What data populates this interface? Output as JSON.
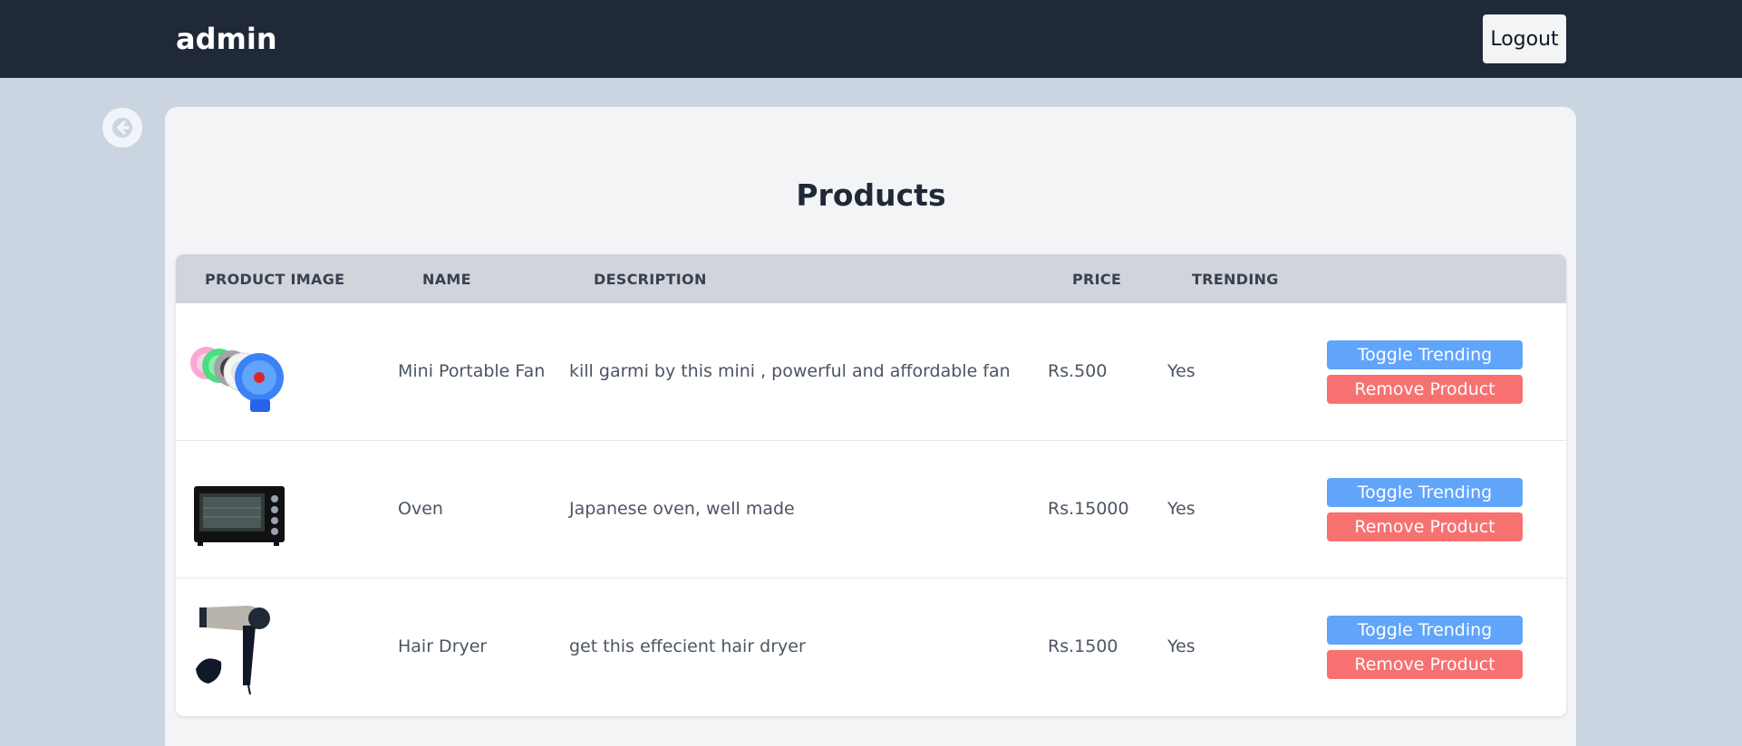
{
  "header": {
    "brand": "admin",
    "logout_label": "Logout"
  },
  "page": {
    "title": "Products"
  },
  "table": {
    "columns": [
      "PRODUCT IMAGE",
      "NAME",
      "DESCRIPTION",
      "PRICE",
      "TRENDING"
    ],
    "rows": [
      {
        "image": "mini-fan-image",
        "name": "Mini Portable Fan",
        "description": "kill garmi by this mini , powerful and affordable fan",
        "price": "Rs.500",
        "trending": "Yes"
      },
      {
        "image": "oven-image",
        "name": "Oven",
        "description": "Japanese oven, well made",
        "price": "Rs.15000",
        "trending": "Yes"
      },
      {
        "image": "hair-dryer-image",
        "name": "Hair Dryer",
        "description": "get this effecient hair dryer",
        "price": "Rs.1500",
        "trending": "Yes"
      }
    ]
  },
  "actions": {
    "toggle_label": "Toggle Trending",
    "remove_label": "Remove Product"
  },
  "colors": {
    "navbar": "#1f2937",
    "background": "#cbd5e1",
    "toggle": "#60a5fa",
    "remove": "#f87171"
  }
}
